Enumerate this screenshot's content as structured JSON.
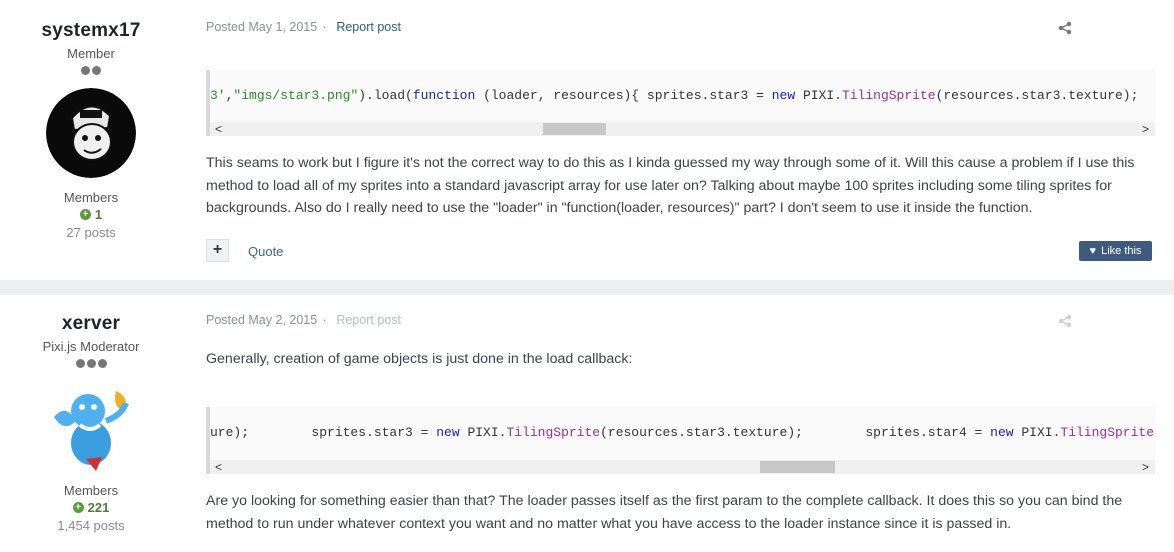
{
  "posts": [
    {
      "author": {
        "name": "systemx17",
        "title": "Member",
        "rank_dots": 2,
        "group": "Members",
        "reputation": "1",
        "post_count": "27 posts"
      },
      "posted": "Posted May 1, 2015",
      "separator": "·",
      "report": "Report post",
      "code": {
        "segments": [
          {
            "text": "3'",
            "cls": "str"
          },
          {
            "text": ",",
            "cls": ""
          },
          {
            "text": "\"imgs/star3.png\"",
            "cls": "str"
          },
          {
            "text": ").load(",
            "cls": ""
          },
          {
            "text": "function",
            "cls": "kw"
          },
          {
            "text": " (loader, resources){ sprites.star3 = ",
            "cls": ""
          },
          {
            "text": "new",
            "cls": "kw"
          },
          {
            "text": " PIXI.",
            "cls": ""
          },
          {
            "text": "TilingSprite",
            "cls": "cls"
          },
          {
            "text": "(resources.star3.texture);",
            "cls": ""
          }
        ]
      },
      "body": "This seams to work but I figure it's not the correct way to do this as I kinda guessed my way through some of it. Will this cause a problem if I use this method to load all of my sprites into a standard javascript array for use later on? Talking about maybe 100 sprites including some tiling sprites for backgrounds. Also do I really need to use the \"loader\" in \"function(loader, resources)\" part? I don't seem to use it inside the function.",
      "quote_label": "Quote",
      "like_label": "Like this"
    },
    {
      "author": {
        "name": "xerver",
        "title": "Pixi.js Moderator",
        "rank_dots": 3,
        "group": "Members",
        "reputation": "221",
        "post_count": "1,454 posts"
      },
      "posted": "Posted May 2, 2015",
      "separator": "·",
      "report": "Report post",
      "intro": "Generally, creation of game objects is just done in the load callback:",
      "code": {
        "segments": [
          {
            "text": "ure);        sprites.star3 = ",
            "cls": ""
          },
          {
            "text": "new",
            "cls": "kw"
          },
          {
            "text": " PIXI.",
            "cls": ""
          },
          {
            "text": "TilingSprite",
            "cls": "cls"
          },
          {
            "text": "(resources.star3.texture);        sprites.star4 = ",
            "cls": ""
          },
          {
            "text": "new",
            "cls": "kw"
          },
          {
            "text": " PIXI.",
            "cls": ""
          },
          {
            "text": "TilingSprite",
            "cls": "cls"
          }
        ]
      },
      "body": "Are yo looking for something easier than that? The loader passes itself as the first param to the complete callback. It does this so you can bind the method to run under whatever context you want and no matter what you have access to the loader instance since it is passed in."
    }
  ],
  "scroll_arrows": {
    "left": "<",
    "right": ">"
  },
  "colors": {
    "like_button": "#3f5a7f",
    "link": "#2a5d8c",
    "reputation": "#4d7b2f"
  },
  "icons": {
    "share": "share-icon",
    "heart": "heart-icon",
    "rep": "plus-circle-icon"
  }
}
